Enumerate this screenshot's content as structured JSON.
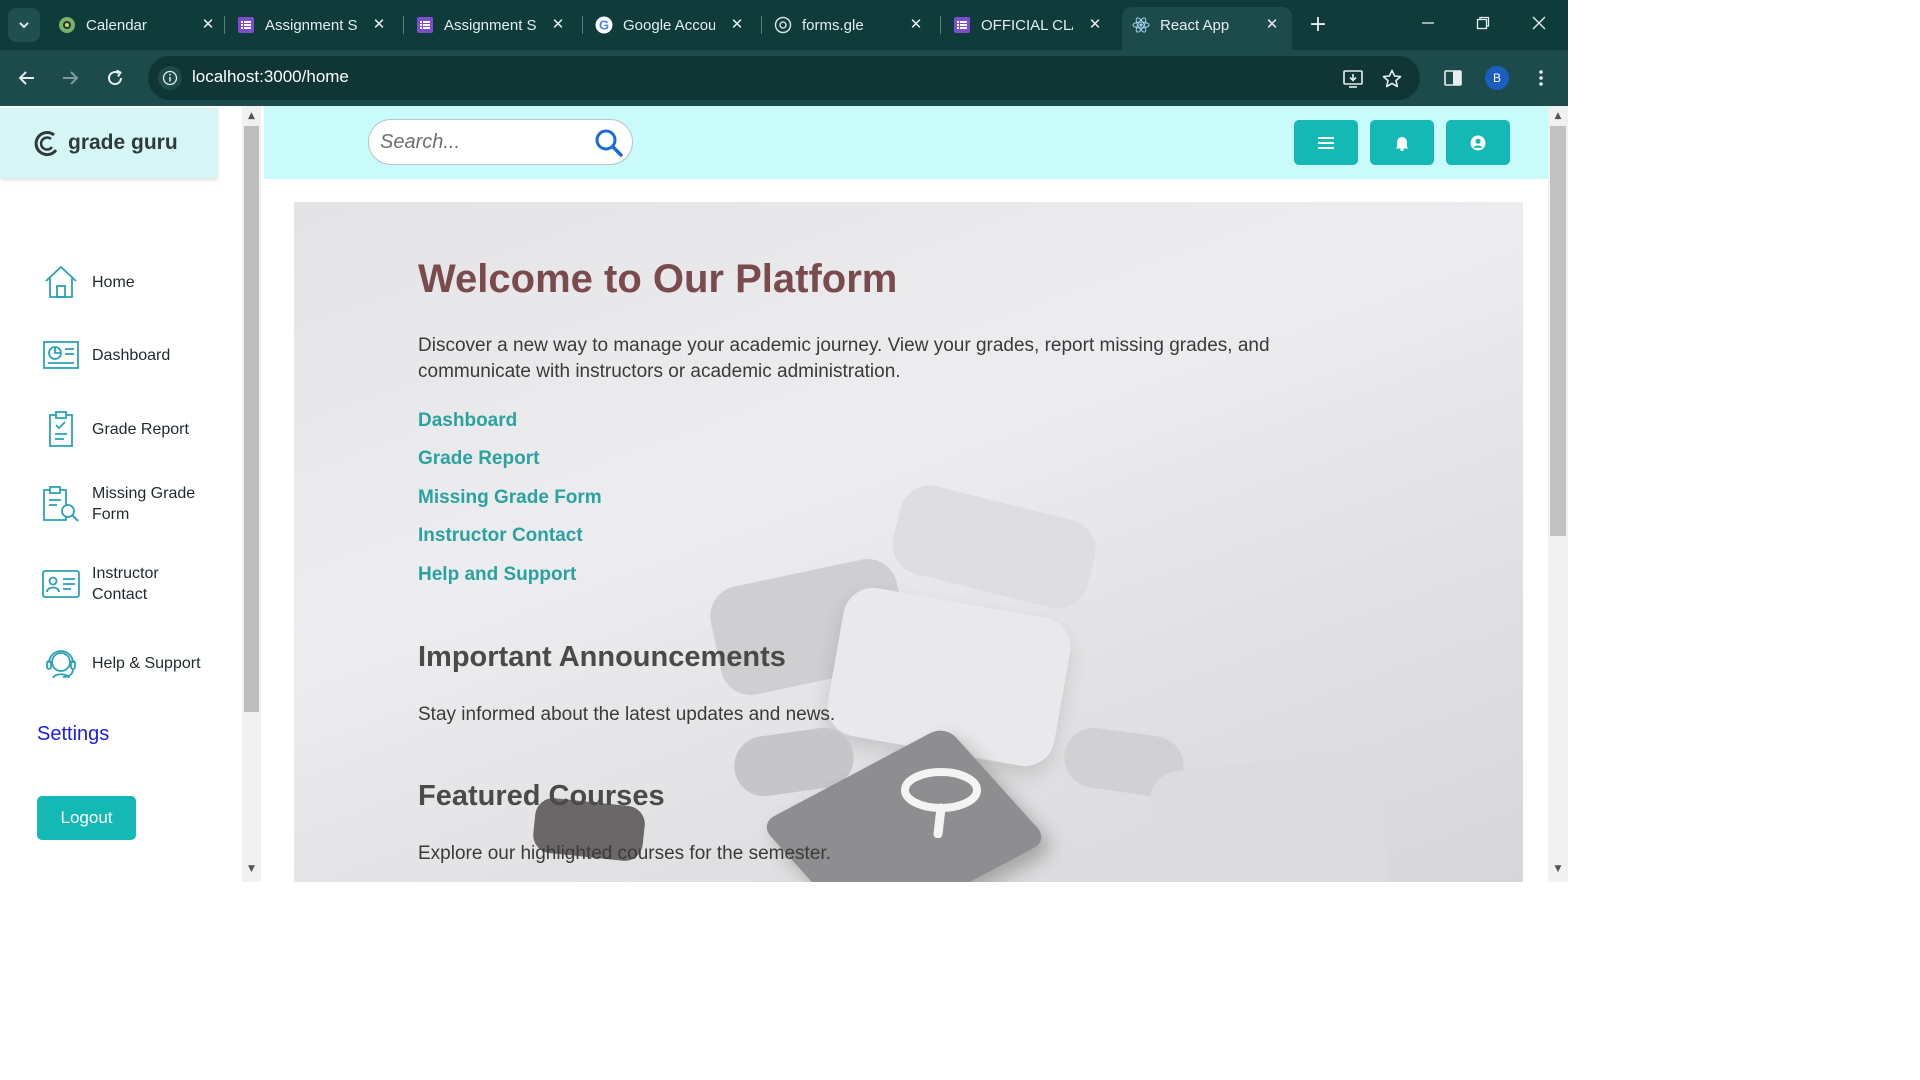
{
  "browser": {
    "tabs": [
      {
        "title": "Calendar",
        "favicon": "calendar-icon"
      },
      {
        "title": "Assignment Su",
        "favicon": "forms-icon"
      },
      {
        "title": "Assignment Su",
        "favicon": "forms-icon"
      },
      {
        "title": "Google Accou",
        "favicon": "google-icon"
      },
      {
        "title": "forms.gle",
        "favicon": "globe-icon"
      },
      {
        "title": "OFFICIAL CLA",
        "favicon": "forms-icon"
      },
      {
        "title": "React App",
        "favicon": "react-icon",
        "active": true
      }
    ],
    "url": "localhost:3000/home",
    "profile_initial": "B"
  },
  "sidebar": {
    "brand": "grade guru",
    "items": [
      {
        "label": "Home",
        "icon": "home-icon"
      },
      {
        "label": "Dashboard",
        "icon": "dashboard-icon"
      },
      {
        "label": "Grade Report",
        "icon": "clipboard-check-icon"
      },
      {
        "label": "Missing Grade Form",
        "icon": "clipboard-search-icon"
      },
      {
        "label": "Instructor Contact",
        "icon": "contact-card-icon"
      },
      {
        "label": "Help & Support",
        "icon": "headset-icon"
      }
    ],
    "settings": "Settings",
    "logout": "Logout"
  },
  "header": {
    "search_placeholder": "Search...",
    "buttons": [
      "menu-icon",
      "bell-icon",
      "user-icon"
    ]
  },
  "main": {
    "title": "Welcome to Our Platform",
    "intro": "Discover a new way to manage your academic journey. View your grades, report missing grades, and communicate with instructors or academic administration.",
    "links": [
      "Dashboard",
      "Grade Report",
      "Missing Grade Form",
      "Instructor Contact",
      "Help and Support"
    ],
    "announcements_title": "Important Announcements",
    "announcements_text": "Stay informed about the latest updates and news.",
    "featured_title": "Featured Courses",
    "featured_text": "Explore our highlighted courses for the semester."
  },
  "colors": {
    "accent": "#14b8b4",
    "header_bg": "#c9fbfb",
    "title": "#7a4b4d",
    "link": "#2aa29f",
    "browser_frame": "#0f3b3b"
  }
}
